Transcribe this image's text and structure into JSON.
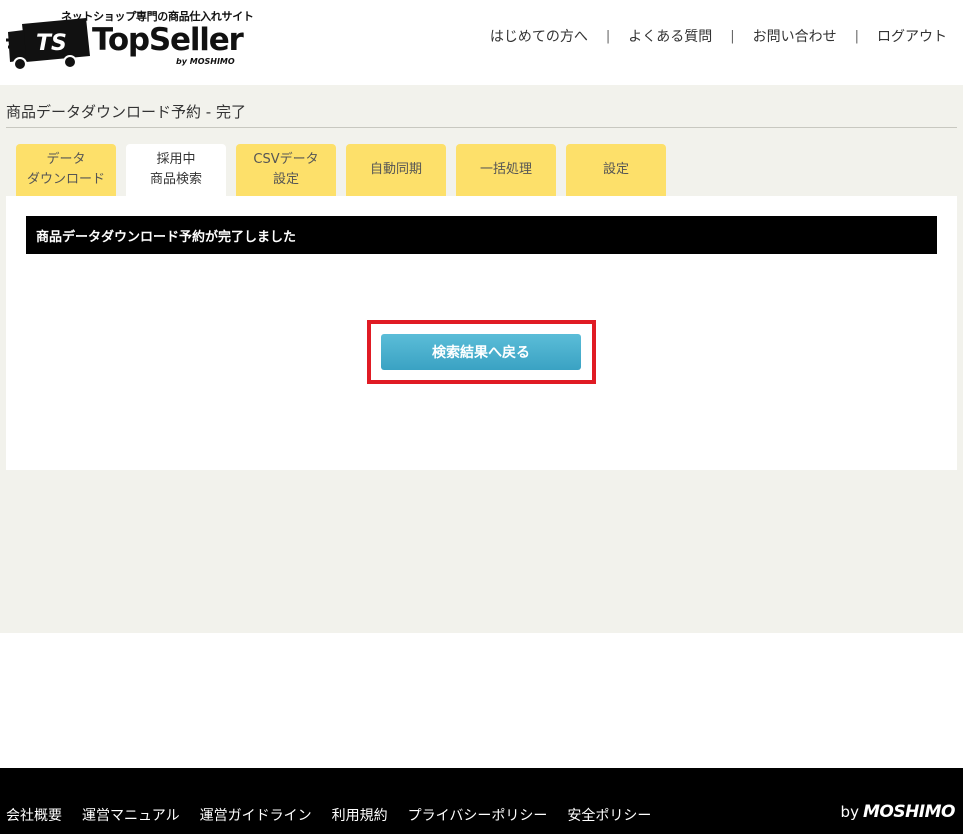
{
  "header": {
    "tagline": "ネットショップ専門の商品仕入れサイト",
    "logo_mark": "TS",
    "logo_name": "TopSeller",
    "logo_by": "by MOSHIMO",
    "nav": [
      {
        "label": "はじめての方へ"
      },
      {
        "label": "よくある質問"
      },
      {
        "label": "お問い合わせ"
      },
      {
        "label": "ログアウト"
      }
    ],
    "nav_separator": "|"
  },
  "main": {
    "page_title": "商品データダウンロード予約 - 完了",
    "tabs": [
      {
        "label": "データ\nダウンロード",
        "active": false
      },
      {
        "label": "採用中\n商品検索",
        "active": true
      },
      {
        "label": "CSVデータ\n設定",
        "active": false
      },
      {
        "label": "自動同期",
        "active": false
      },
      {
        "label": "一括処理",
        "active": false
      },
      {
        "label": "設定",
        "active": false
      }
    ],
    "notice": "商品データダウンロード予約が完了しました",
    "back_button": "検索結果へ戻る"
  },
  "footer": {
    "links": [
      {
        "label": "会社概要"
      },
      {
        "label": "運営マニュアル"
      },
      {
        "label": "運営ガイドライン"
      },
      {
        "label": "利用規約"
      },
      {
        "label": "プライバシーポリシー"
      },
      {
        "label": "安全ポリシー"
      }
    ],
    "brand_by": "by",
    "brand_mark": "MOSHIMO"
  },
  "colors": {
    "tab_yellow": "#fde06a",
    "button_blue": "#44aecb",
    "highlight_red": "#e01b24",
    "main_bg": "#f2f2ec"
  }
}
